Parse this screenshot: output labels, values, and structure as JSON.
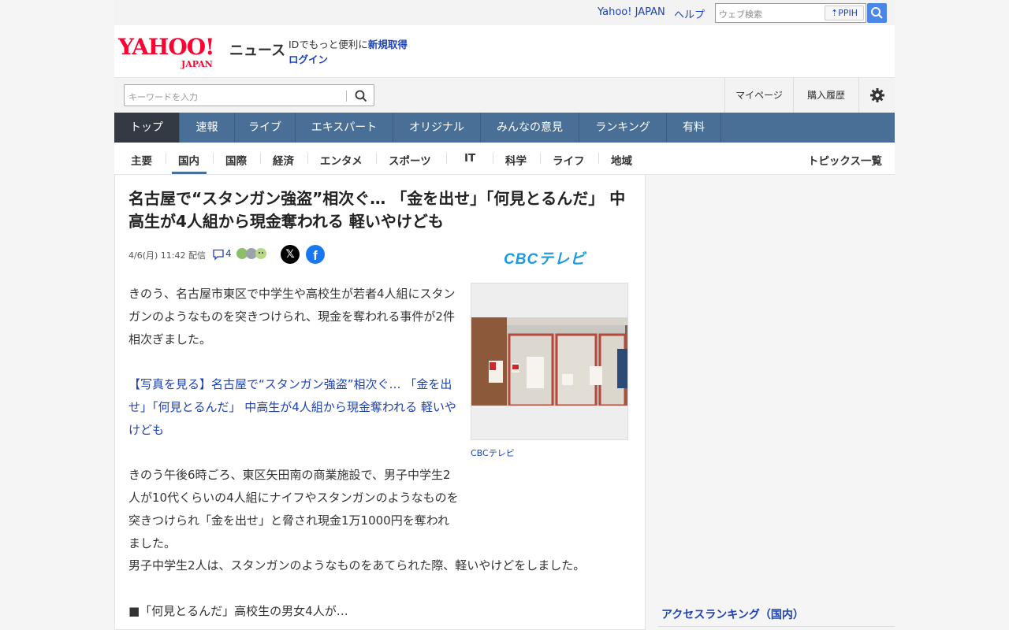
{
  "topbar": {
    "yahoo_japan": "Yahoo! JAPAN",
    "help": "ヘルプ",
    "web_search_placeholder": "ウェブ検索",
    "ppih": "PPIH"
  },
  "header": {
    "logo_word": "YAHOO!",
    "logo_japan": "JAPAN",
    "news_label": "ニュース",
    "id_prefix": "IDでもっと便利に",
    "signup": "新規取得",
    "login": "ログイン"
  },
  "search": {
    "placeholder": "キーワードを入力",
    "mypage": "マイページ",
    "purchase_history": "購入履歴"
  },
  "main_nav": [
    "トップ",
    "速報",
    "ライブ",
    "エキスパート",
    "オリジナル",
    "みんなの意見",
    "ランキング",
    "有料"
  ],
  "sub_nav": [
    "主要",
    "国内",
    "国際",
    "経済",
    "エンタメ",
    "スポーツ",
    "IT",
    "科学",
    "ライフ",
    "地域"
  ],
  "sub_nav_topics": "トピックス一覧",
  "article": {
    "headline": "名古屋で“スタンガン強盗”相次ぐ… 「金を出せ」「何見とるんだ」 中高生が4人組から現金奪われる 軽いやけども",
    "date": "4/6(月) 11:42 配信",
    "comment_count": "4",
    "source_logo": "CBCテレビ",
    "photo_caption": "CBCテレビ",
    "para1": "きのう、名古屋市東区で中学生や高校生が若者4人組にスタンガンのようなものを突きつけられ、現金を奪われる事件が2件相次ぎました。",
    "photo_link": "【写真を見る】名古屋で“スタンガン強盗”相次ぐ… 「金を出せ」「何見とるんだ」 中高生が4人組から現金奪われる 軽いやけども",
    "para2": "きのう午後6時ごろ、東区矢田南の商業施設で、男子中学生2人が10代くらいの4人組にナイフやスタンガンのようなものを突きつけられ「金を出せ」と脅され現金1万1000円を奪われました。",
    "para3": "男子中学生2人は、スタンガンのようなものをあてられた際、軽いやけどをしました。",
    "para4": "■「何見とるんだ」高校生の男女4人が…"
  },
  "sidebar": {
    "ranking_title": "アクセスランキング（国内）"
  },
  "colors": {
    "nav_bg": "#4a6f96",
    "nav_active": "#333a44",
    "link": "#1e43b6",
    "brand_red": "#ff0033"
  }
}
